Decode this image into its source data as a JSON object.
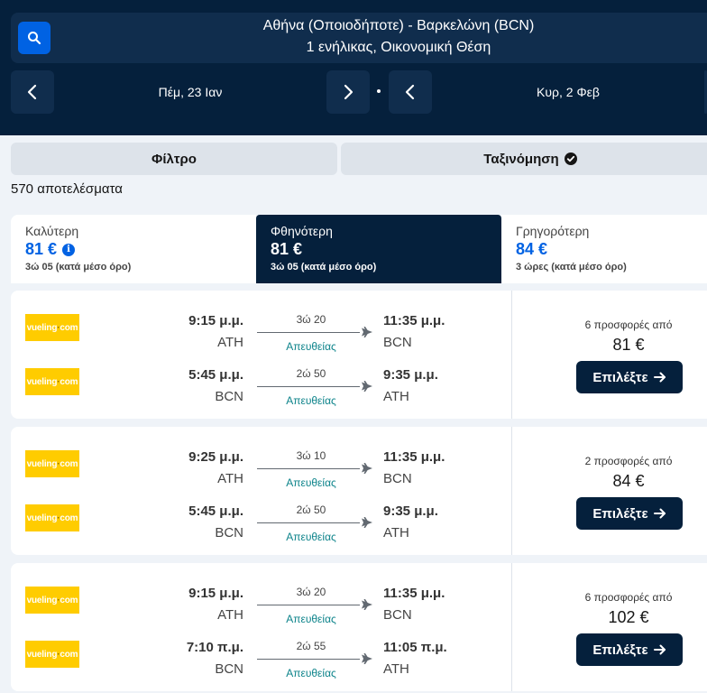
{
  "header": {
    "route": "Αθήνα (Οποιοδήποτε) - Βαρκελώνη (BCN)",
    "passengers": "1 ενήλικας, Οικονομική Θέση",
    "depart_date": "Πέμ, 23 Ιαν",
    "return_date": "Κυρ, 2 Φεβ"
  },
  "filters": {
    "filter_label": "Φίλτρο",
    "sort_label": "Ταξινόμηση"
  },
  "results_count": "570 αποτελέσματα",
  "tabs": [
    {
      "name": "Καλύτερη",
      "price": "81 €",
      "sub": "3ώ 05 (κατά μέσο όρο)"
    },
    {
      "name": "Φθηνότερη",
      "price": "81 €",
      "sub": "3ώ 05 (κατά μέσο όρο)"
    },
    {
      "name": "Γρηγορότερη",
      "price": "84 €",
      "sub": "3 ώρες (κατά μέσο όρο)"
    }
  ],
  "airline_logo_text": "vueling",
  "airline_logo_suffix": "com",
  "select_label": "Επιλέξτε",
  "cards": [
    {
      "offers": "6 προσφορές από",
      "price": "81 €",
      "legs": [
        {
          "dep_time": "9:15 μ.μ.",
          "dep_code": "ATH",
          "duration": "3ώ 20",
          "stop": "Απευθείας",
          "arr_time": "11:35 μ.μ.",
          "arr_code": "BCN"
        },
        {
          "dep_time": "5:45 μ.μ.",
          "dep_code": "BCN",
          "duration": "2ώ 50",
          "stop": "Απευθείας",
          "arr_time": "9:35 μ.μ.",
          "arr_code": "ATH"
        }
      ]
    },
    {
      "offers": "2 προσφορές από",
      "price": "84 €",
      "legs": [
        {
          "dep_time": "9:25 μ.μ.",
          "dep_code": "ATH",
          "duration": "3ώ 10",
          "stop": "Απευθείας",
          "arr_time": "11:35 μ.μ.",
          "arr_code": "BCN"
        },
        {
          "dep_time": "5:45 μ.μ.",
          "dep_code": "BCN",
          "duration": "2ώ 50",
          "stop": "Απευθείας",
          "arr_time": "9:35 μ.μ.",
          "arr_code": "ATH"
        }
      ]
    },
    {
      "offers": "6 προσφορές από",
      "price": "102 €",
      "legs": [
        {
          "dep_time": "9:15 μ.μ.",
          "dep_code": "ATH",
          "duration": "3ώ 20",
          "stop": "Απευθείας",
          "arr_time": "11:35 μ.μ.",
          "arr_code": "BCN"
        },
        {
          "dep_time": "7:10 π.μ.",
          "dep_code": "BCN",
          "duration": "2ώ 55",
          "stop": "Απευθείας",
          "arr_time": "11:05 π.μ.",
          "arr_code": "ATH"
        }
      ]
    }
  ],
  "colors": {
    "header_bg": "#05203c",
    "accent_blue": "#0062e3",
    "direct_teal": "#0c838a",
    "airline_yellow": "#ffcc00"
  }
}
